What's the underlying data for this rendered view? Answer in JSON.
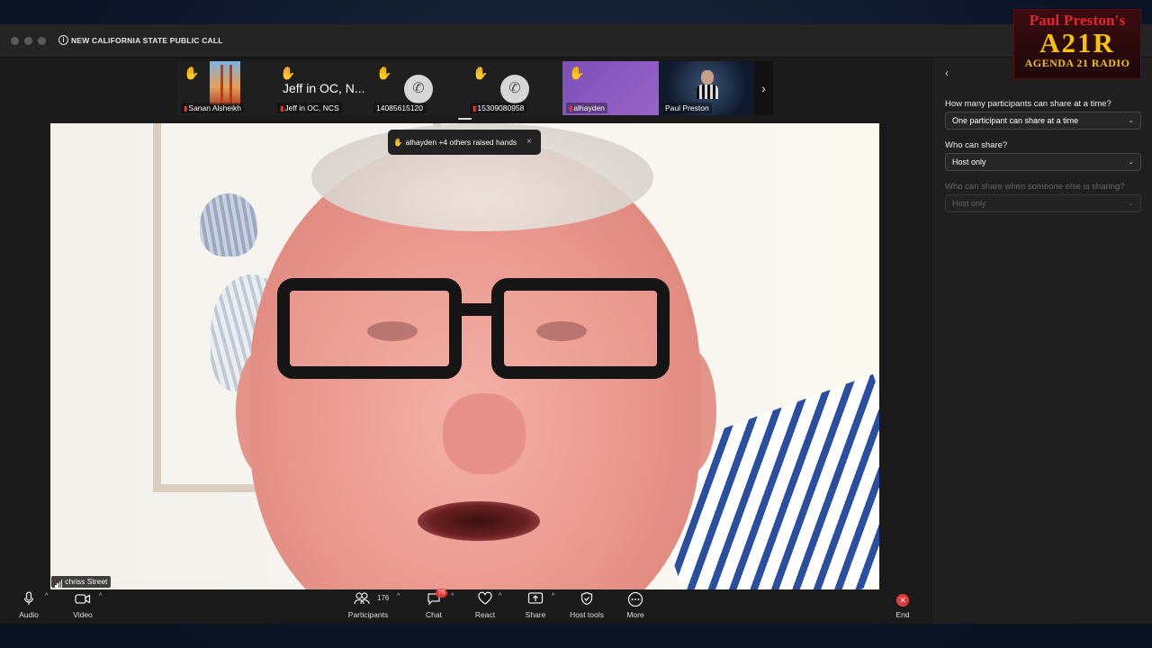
{
  "window": {
    "title": "NEW CALIFORNIA STATE PUBLIC CALL"
  },
  "logo": {
    "line1": "Paul Preston's",
    "line2": "A21R",
    "line3": "AGENDA 21 RADIO"
  },
  "gallery": {
    "tiles": [
      {
        "name": "Sanan Alsheikh",
        "raised_hand": true,
        "muted": true,
        "kind": "photo"
      },
      {
        "name": "Jeff in OC, NCS",
        "display": "Jeff in OC, N...",
        "raised_hand": true,
        "muted": true,
        "kind": "text"
      },
      {
        "name": "14085615120",
        "raised_hand": true,
        "muted": false,
        "kind": "phone"
      },
      {
        "name": "15309080958",
        "raised_hand": true,
        "muted": true,
        "kind": "phone"
      },
      {
        "name": "alhayden",
        "raised_hand": true,
        "muted": true,
        "kind": "purple"
      },
      {
        "name": "Paul Preston",
        "raised_hand": false,
        "muted": false,
        "kind": "video"
      }
    ],
    "next_icon": "chevron-right-icon"
  },
  "notification": {
    "text": "alhayden +4 others raised hands",
    "close": "×"
  },
  "speaker": {
    "name": "chriss Street"
  },
  "sharing_panel": {
    "q1": "How many participants can share at a time?",
    "q1_value": "One participant can share at a time",
    "q2": "Who can share?",
    "q2_value": "Host only",
    "q3": "Who can share when someone else is sharing?",
    "q3_value": "Host only"
  },
  "toolbar": {
    "audio": "Audio",
    "video": "Video",
    "participants": "Participants",
    "participants_count": "176",
    "chat": "Chat",
    "chat_badge": "76",
    "react": "React",
    "share": "Share",
    "host_tools": "Host tools",
    "more": "More",
    "end": "End"
  },
  "colors": {
    "accent_red": "#e53935",
    "hand_yellow": "#f1c232",
    "panel_bg": "#1f1f1f"
  }
}
